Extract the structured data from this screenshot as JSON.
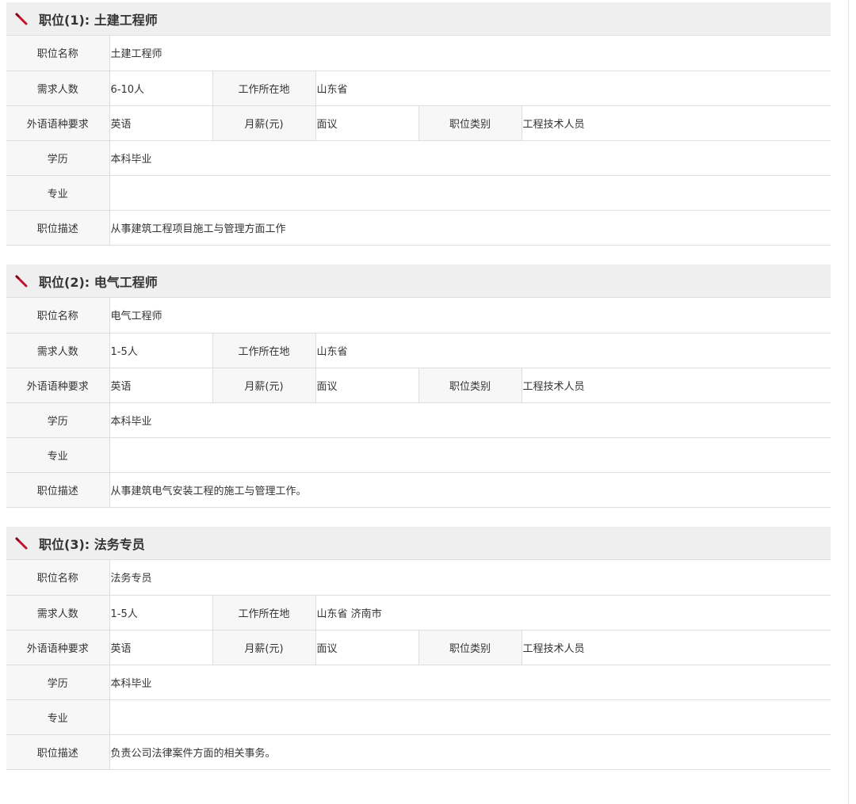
{
  "jobs": [
    {
      "title": "职位(1): 土建工程师",
      "labels": {
        "name": "职位名称",
        "headcount": "需求人数",
        "location": "工作所在地",
        "language": "外语语种要求",
        "salary": "月薪(元)",
        "category": "职位类别",
        "education": "学历",
        "major": "专业",
        "description": "职位描述"
      },
      "values": {
        "name": "土建工程师",
        "headcount": "6-10人",
        "location": "山东省",
        "language": "英语",
        "salary": "面议",
        "category": "工程技术人员",
        "education": "本科毕业",
        "major": "",
        "description": "从事建筑工程项目施工与管理方面工作"
      }
    },
    {
      "title": "职位(2): 电气工程师",
      "labels": {
        "name": "职位名称",
        "headcount": "需求人数",
        "location": "工作所在地",
        "language": "外语语种要求",
        "salary": "月薪(元)",
        "category": "职位类别",
        "education": "学历",
        "major": "专业",
        "description": "职位描述"
      },
      "values": {
        "name": "电气工程师",
        "headcount": "1-5人",
        "location": "山东省",
        "language": "英语",
        "salary": "面议",
        "category": "工程技术人员",
        "education": "本科毕业",
        "major": "",
        "description": "从事建筑电气安装工程的施工与管理工作。"
      }
    },
    {
      "title": "职位(3): 法务专员",
      "labels": {
        "name": "职位名称",
        "headcount": "需求人数",
        "location": "工作所在地",
        "language": "外语语种要求",
        "salary": "月薪(元)",
        "category": "职位类别",
        "education": "学历",
        "major": "专业",
        "description": "职位描述"
      },
      "values": {
        "name": "法务专员",
        "headcount": "1-5人",
        "location": "山东省 济南市",
        "language": "英语",
        "salary": "面议",
        "category": "工程技术人员",
        "education": "本科毕业",
        "major": "",
        "description": "负责公司法律案件方面的相关事务。"
      }
    }
  ],
  "icons": {
    "header_icon": "pencil-icon"
  },
  "colors": {
    "icon_accent": "#c8102e",
    "header_bg": "#efefef",
    "label_bg": "#f7f7f7",
    "border": "#dedede"
  }
}
